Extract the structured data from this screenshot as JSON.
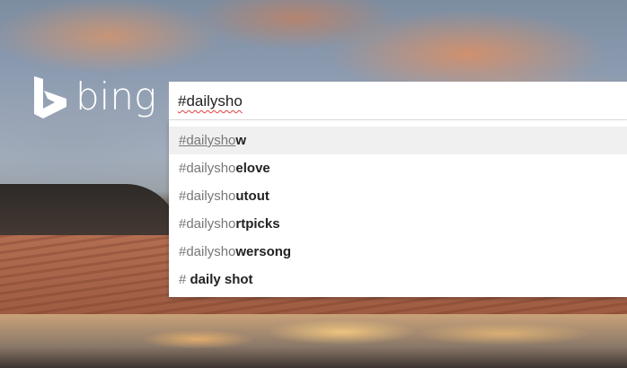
{
  "brand": {
    "name": "bing",
    "logo_icon": "bing-b-logo-icon"
  },
  "search": {
    "value": "#dailysho"
  },
  "suggestions": [
    {
      "typed": "#dailysho",
      "rest": "w"
    },
    {
      "typed": "#dailysho",
      "rest": "elove"
    },
    {
      "typed": "#dailysho",
      "rest": "utout"
    },
    {
      "typed": "#dailysho",
      "rest": "rtpicks"
    },
    {
      "typed": "#dailysho",
      "rest": "wersong"
    },
    {
      "typed": "# ",
      "rest": "daily shot"
    }
  ]
}
